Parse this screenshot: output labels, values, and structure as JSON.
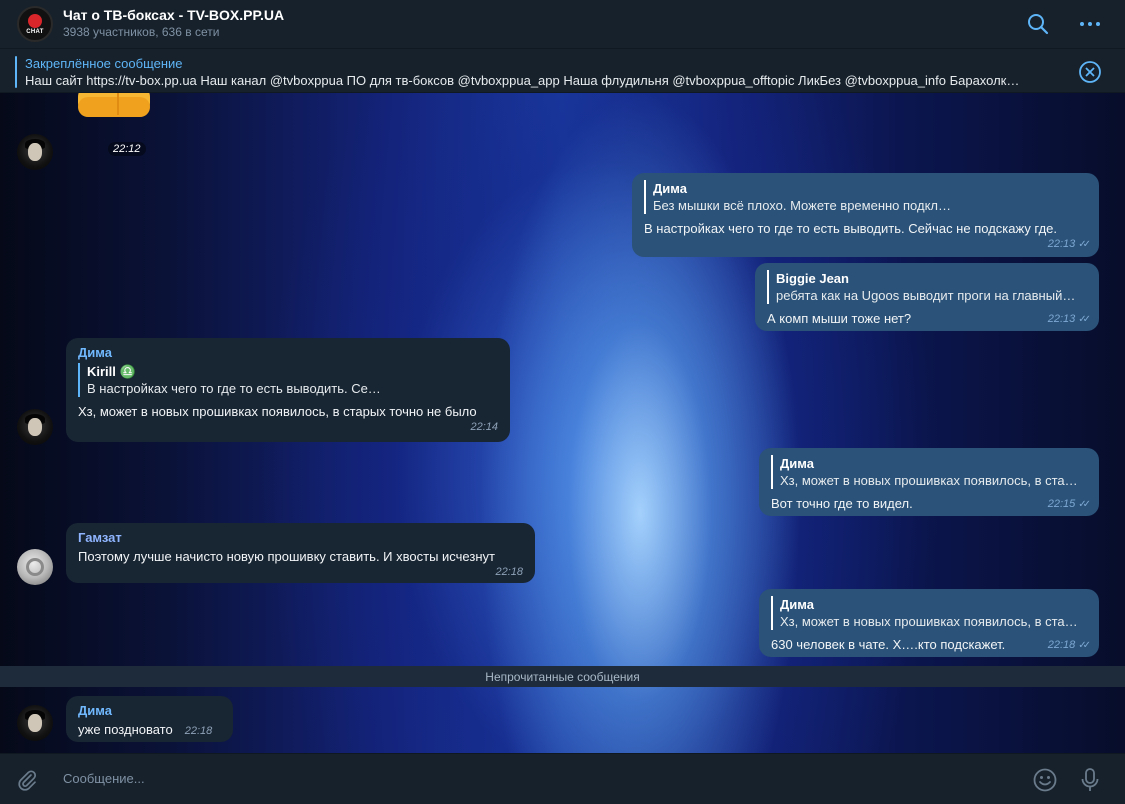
{
  "header": {
    "title": "Чат о ТВ-боксах - TV-BOX.PP.UA",
    "subtitle": "3938 участников, 636 в сети",
    "avatar_text": "CHAT",
    "search_icon": "search-icon",
    "more_icon": "more-dots-icon",
    "accent": "#5eb5f7"
  },
  "pinned": {
    "title": "Закреплённое сообщение",
    "text": "Наш сайт https://tv-box.pp.ua  Наш канал @tvboxppua  ПО для тв-боксов @tvboxppua_app  Наша флудильня @tvboxppua_offtopic  ЛикБез @tvboxppua_info  Барахолк…",
    "close_icon": "close-circle-icon"
  },
  "messages": {
    "m0": {
      "type": "sticker",
      "sticker_icon": "thumbs-up-sticker",
      "time": "22:12"
    },
    "m1": {
      "direction": "out",
      "reply_name": "Дима",
      "reply_text": "Без мышки всё плохо. Можете временно подкл…",
      "text": "В настройках чего то где то есть выводить. Сейчас не подскажу где.",
      "time": "22:13"
    },
    "m2": {
      "direction": "out",
      "reply_name": "Biggie Jean",
      "reply_text": "ребята как на Ugoos выводит проги на главный…",
      "text": "А комп мыши тоже нет?",
      "time": "22:13"
    },
    "m3": {
      "direction": "in",
      "sender": "Дима",
      "reply_name": "Kirill ♎",
      "reply_text": "В настройках чего то где то есть выводить. Се…",
      "text": "Хз, может в новых прошивках появилось, в старых точно не было",
      "time": "22:14"
    },
    "m4": {
      "direction": "out",
      "reply_name": "Дима",
      "reply_text": "Хз, может в новых прошивках появилось, в ста…",
      "text": "Вот точно где то видел.",
      "time": "22:15"
    },
    "m5": {
      "direction": "in",
      "sender": "Гамзат",
      "text": "Поэтому лучше начисто новую прошивку ставить. И хвосты исчезнут",
      "time": "22:18"
    },
    "m6": {
      "direction": "out",
      "reply_name": "Дима",
      "reply_text": "Хз, может в новых прошивках появилось, в ста…",
      "text": "630 человек в чате. Х….кто подскажет.",
      "time": "22:18"
    },
    "m7": {
      "direction": "in",
      "sender": "Дима",
      "text": "уже поздновато",
      "time": "22:18"
    }
  },
  "unread_label": "Непрочитанные сообщения",
  "composer": {
    "placeholder": "Сообщение...",
    "attach_icon": "paperclip-icon",
    "emoji_icon": "emoji-icon",
    "mic_icon": "microphone-icon"
  },
  "colors": {
    "incoming_bubble": "#182533",
    "outgoing_bubble": "#2b5278",
    "background": "#17212b"
  }
}
